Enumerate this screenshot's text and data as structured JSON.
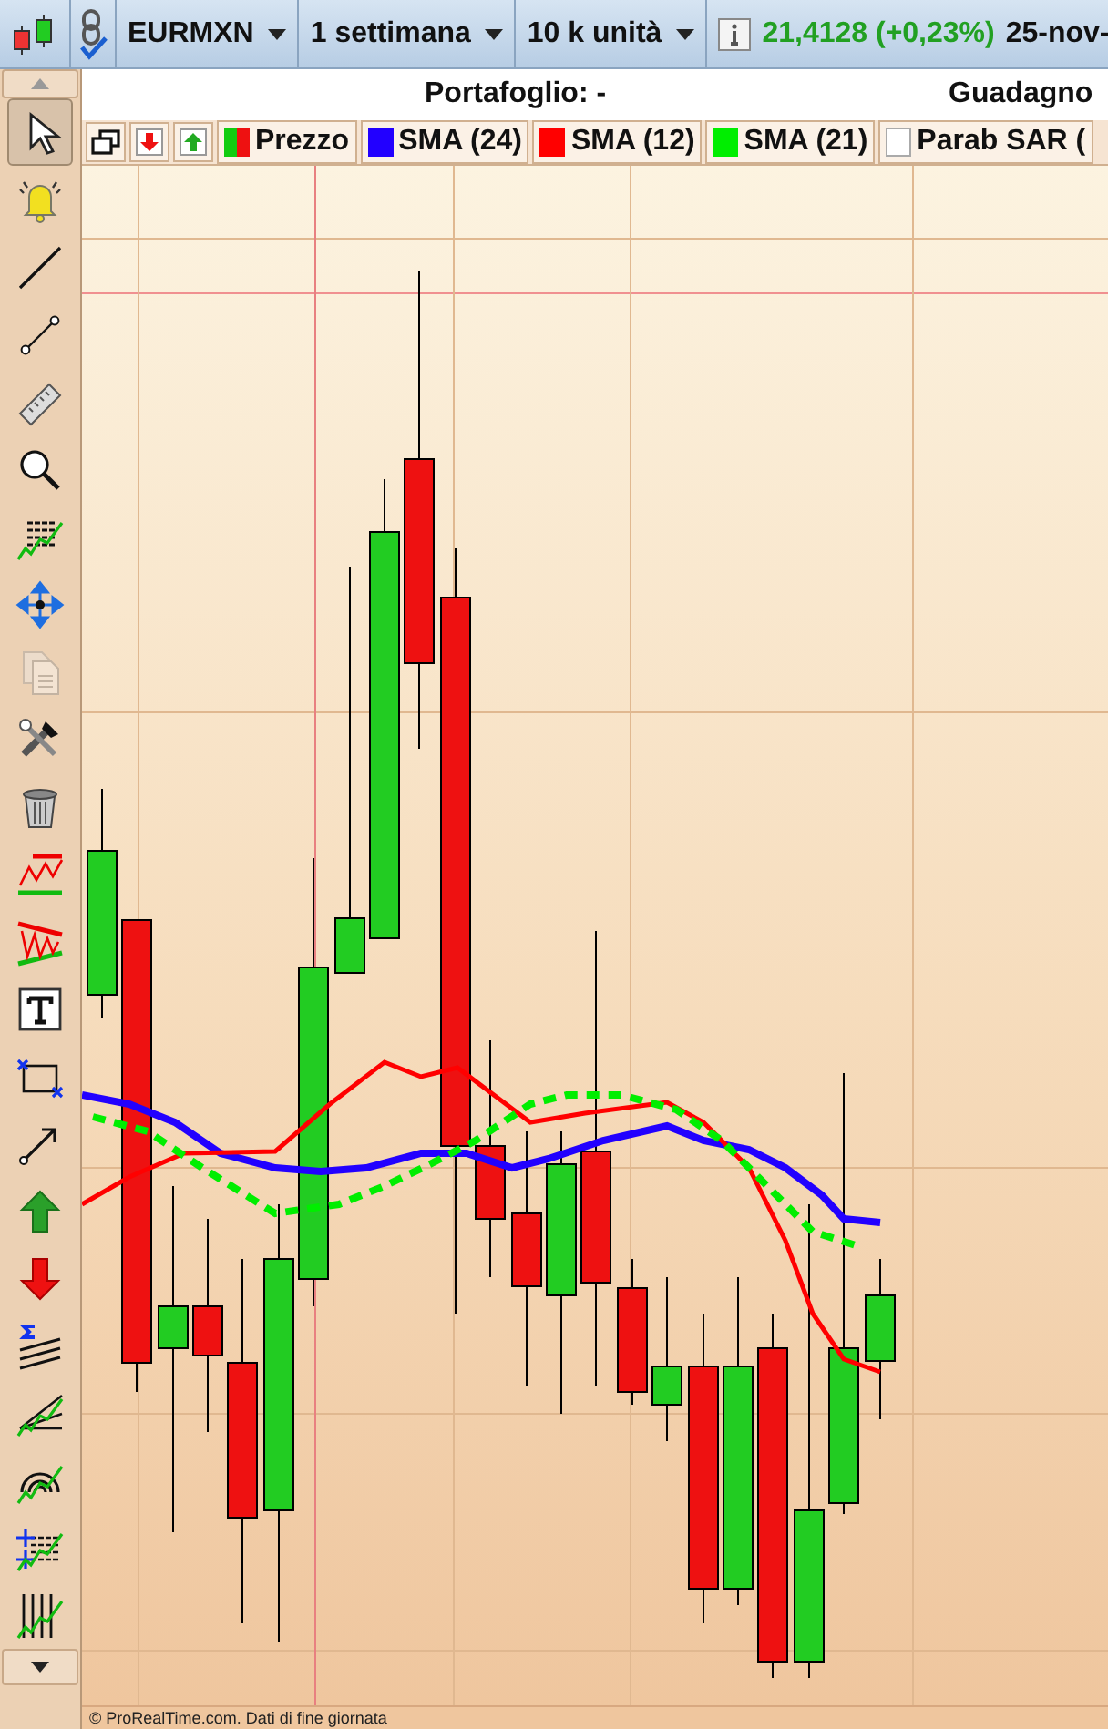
{
  "toolbar": {
    "symbol": "EURMXN",
    "period": "1 settimana",
    "size": "10 k unità",
    "price": "21,4128 (+0,23%)",
    "date": "25-nov-"
  },
  "info_bar": {
    "portfolio": "Portafoglio: -",
    "gain": "Guadagno"
  },
  "legend": [
    {
      "kind": "split",
      "label": "Prezzo"
    },
    {
      "kind": "swatch",
      "label": "SMA (24)",
      "color": "#2200ff"
    },
    {
      "kind": "swatch",
      "label": "SMA (12)",
      "color": "#ff0000"
    },
    {
      "kind": "swatch",
      "label": "SMA (21)",
      "color": "#00ee00"
    },
    {
      "kind": "empty",
      "label": "Parab SAR ("
    }
  ],
  "tools": [
    {
      "kind": "pointer",
      "selected": true
    },
    {
      "kind": "bell",
      "selected": false
    },
    {
      "kind": "line",
      "selected": false
    },
    {
      "kind": "segment",
      "selected": false
    },
    {
      "kind": "ruler",
      "selected": false
    },
    {
      "kind": "zoom",
      "selected": false
    },
    {
      "kind": "fib",
      "selected": false
    },
    {
      "kind": "move",
      "selected": false
    },
    {
      "kind": "copy",
      "selected": false,
      "disabled": true
    },
    {
      "kind": "tools",
      "selected": false
    },
    {
      "kind": "trash",
      "selected": false
    },
    {
      "kind": "channel",
      "selected": false
    },
    {
      "kind": "triangle",
      "selected": false
    },
    {
      "kind": "text",
      "selected": false
    },
    {
      "kind": "rect",
      "selected": false
    },
    {
      "kind": "arrow",
      "selected": false
    },
    {
      "kind": "up",
      "selected": false
    },
    {
      "kind": "down",
      "selected": false
    },
    {
      "kind": "sigma",
      "selected": false
    },
    {
      "kind": "fan",
      "selected": false
    },
    {
      "kind": "arcs",
      "selected": false
    },
    {
      "kind": "fibcross",
      "selected": false
    },
    {
      "kind": "vlines",
      "selected": false
    }
  ],
  "footer": "© ProRealTime.com. Dati di fine giornata"
}
